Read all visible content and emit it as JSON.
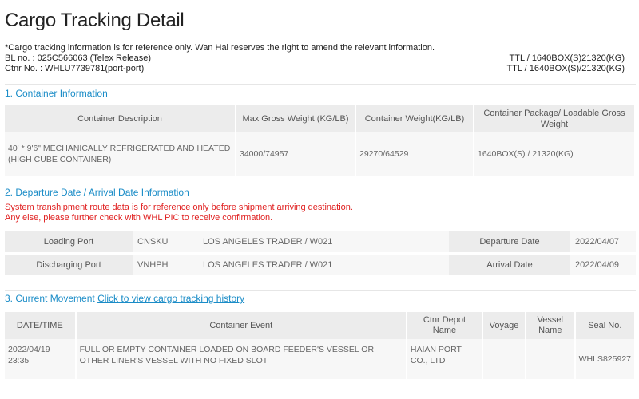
{
  "page": {
    "title": "Cargo Tracking Detail"
  },
  "meta": {
    "disclaimer": "*Cargo tracking information is for reference only. Wan Hai reserves the right to amend the relevant information.",
    "bl_line": "BL no. : 025C566063 (Telex Release)",
    "ctnr_line": "Ctnr No. : WHLU7739781(port-port)",
    "ttl_1": "TTL / 1640BOX(S)21320(KG)",
    "ttl_2": "TTL / 1640BOX(S)/21320(KG)"
  },
  "container_info": {
    "heading": "1. Container Information",
    "headers": {
      "desc": "Container Description",
      "max_gross": "Max Gross Weight (KG/LB)",
      "container_weight": "Container Weight(KG/LB)",
      "package": "Container Package/ Loadable Gross Weight"
    },
    "row": {
      "desc_line1": "40' * 9'6\" MECHANICALLY REFRIGERATED AND HEATED",
      "desc_line2": "(HIGH CUBE CONTAINER)",
      "max_gross": "34000/74957",
      "container_weight": "29270/64529",
      "package": "1640BOX(S) / 21320(KG)"
    }
  },
  "departure": {
    "heading": "2. Departure Date / Arrival Date Information",
    "warning_1": "System transhipment route data is for reference only before shipment arriving destination.",
    "warning_2": "Any else, please further check with WHL PIC to receive confirmation.",
    "loading": {
      "label": "Loading Port",
      "code": "CNSKU",
      "vessel": "LOS ANGELES TRADER / W021",
      "date_label": "Departure Date",
      "date": "2022/04/07"
    },
    "discharging": {
      "label": "Discharging Port",
      "code": "VNHPH",
      "vessel": "LOS ANGELES TRADER / W021",
      "date_label": "Arrival Date",
      "date": "2022/04/09"
    }
  },
  "movement": {
    "heading": "3. Current Movement",
    "history_link": "Click to view cargo tracking history",
    "headers": {
      "datetime": "DATE/TIME",
      "event": "Container Event",
      "depot": "Ctnr Depot Name",
      "voyage": "Voyage",
      "vessel": "Vessel Name",
      "seal": "Seal No."
    },
    "row": {
      "date": "2022/04/19",
      "time": "23:35",
      "event": "FULL OR EMPTY CONTAINER LOADED ON BOARD FEEDER'S VESSEL OR OTHER LINER'S VESSEL WITH NO FIXED SLOT",
      "depot": "HAIAN PORT CO., LTD",
      "voyage": "",
      "vessel": "",
      "seal": "WHLS825927"
    }
  }
}
